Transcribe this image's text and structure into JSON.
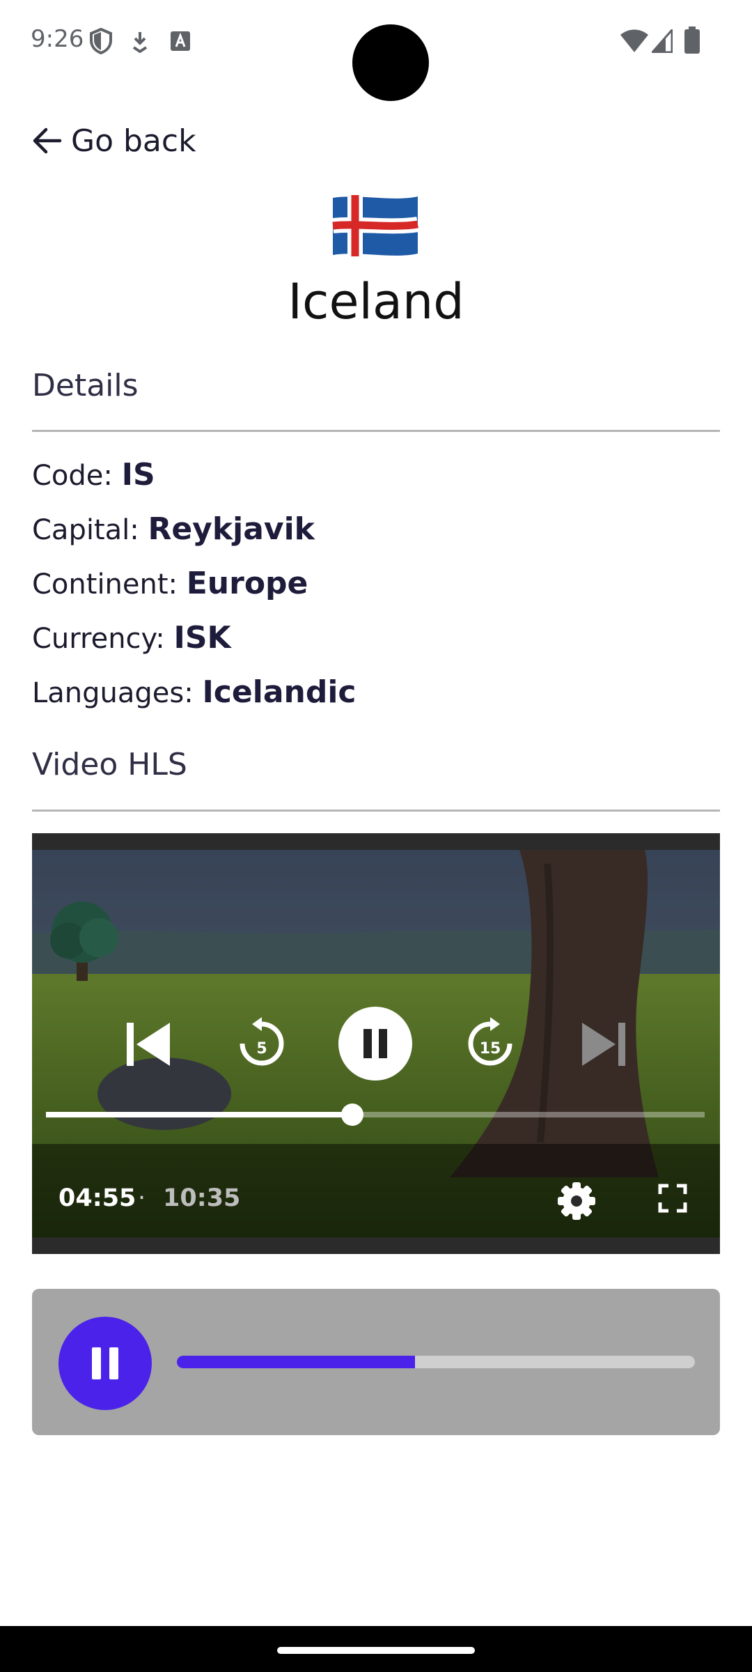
{
  "status_bar": {
    "time": "9:26"
  },
  "header": {
    "back_label": "Go back"
  },
  "country": {
    "name": "Iceland",
    "flag_colors": {
      "field": "#1f5aa6",
      "cross_white": "#ffffff",
      "cross_red": "#d72828"
    }
  },
  "details": {
    "title": "Details",
    "code_label": "Code: ",
    "code_value": "IS",
    "capital_label": "Capital: ",
    "capital_value": "Reykjavik",
    "continent_label": "Continent: ",
    "continent_value": "Europe",
    "currency_label": "Currency: ",
    "currency_value": "ISK",
    "languages_label": "Languages: ",
    "languages_value": "Icelandic"
  },
  "video": {
    "title": "Video HLS",
    "current_time": "04:55",
    "separator": "·",
    "duration": "10:35",
    "progress": 0.465,
    "rewind_seconds": "5",
    "forward_seconds": "15",
    "icons": [
      "skip-previous-icon",
      "replay-5-icon",
      "pause-icon",
      "forward-15-icon",
      "skip-next-icon",
      "settings-gear-icon",
      "fullscreen-icon"
    ]
  },
  "audio": {
    "progress": 0.46,
    "accent_color": "#4b22ea",
    "icon": "pause-icon"
  }
}
